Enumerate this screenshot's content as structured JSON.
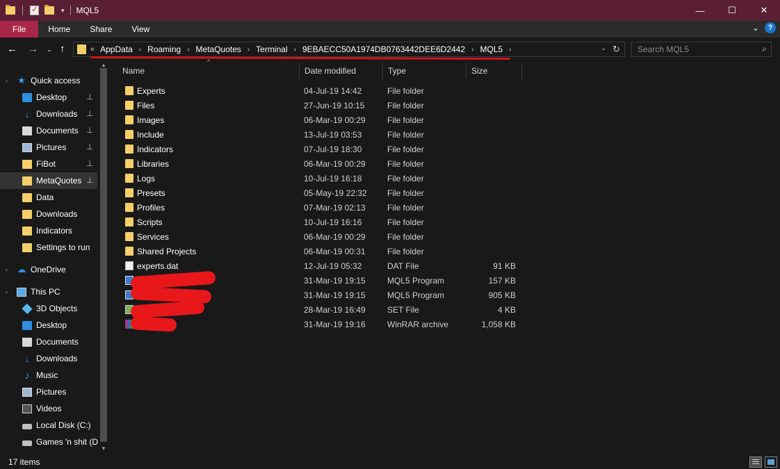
{
  "window": {
    "title": "MQL5",
    "minimize_glyph": "—",
    "maximize_glyph": "☐",
    "close_glyph": "✕"
  },
  "ribbon": {
    "tabs": [
      "File",
      "Home",
      "Share",
      "View"
    ],
    "help_glyph": "?",
    "expand_glyph": "⌄"
  },
  "address": {
    "prefix": "«",
    "crumbs": [
      "AppData",
      "Roaming",
      "MetaQuotes",
      "Terminal",
      "9EBAECC50A1974DB0763442DEE6D2442",
      "MQL5"
    ],
    "separator": "›",
    "refresh_glyph": "↻",
    "dropdown_glyph": "⌄"
  },
  "nav_buttons": {
    "back": "←",
    "forward": "→",
    "recent": "⌄",
    "up": "↑"
  },
  "search": {
    "placeholder": "Search MQL5",
    "value": "",
    "icon_glyph": "⌕"
  },
  "navpane": {
    "items": [
      {
        "label": "Quick access",
        "icon": "star-icon",
        "pinned": false,
        "selected": false,
        "group": true
      },
      {
        "label": "Desktop",
        "icon": "desktop-icon",
        "pinned": true,
        "selected": false
      },
      {
        "label": "Downloads",
        "icon": "download-icon",
        "pinned": true,
        "selected": false
      },
      {
        "label": "Documents",
        "icon": "document-icon",
        "pinned": true,
        "selected": false
      },
      {
        "label": "Pictures",
        "icon": "pictures-icon",
        "pinned": true,
        "selected": false
      },
      {
        "label": "FiBot",
        "icon": "folder-icon",
        "pinned": true,
        "selected": false
      },
      {
        "label": "MetaQuotes",
        "icon": "folder-icon",
        "pinned": true,
        "selected": true
      },
      {
        "label": "Data",
        "icon": "folder-icon",
        "pinned": false,
        "selected": false
      },
      {
        "label": "Downloads",
        "icon": "folder-icon",
        "pinned": false,
        "selected": false
      },
      {
        "label": "Indicators",
        "icon": "folder-icon",
        "pinned": false,
        "selected": false
      },
      {
        "label": "Settings to run",
        "icon": "folder-icon",
        "pinned": false,
        "selected": false
      },
      {
        "label": "OneDrive",
        "icon": "cloud-icon",
        "pinned": false,
        "selected": false,
        "group": true
      },
      {
        "label": "This PC",
        "icon": "pc-icon",
        "pinned": false,
        "selected": false,
        "group": true
      },
      {
        "label": "3D Objects",
        "icon": "cube-icon",
        "pinned": false,
        "selected": false
      },
      {
        "label": "Desktop",
        "icon": "desktop-icon",
        "pinned": false,
        "selected": false
      },
      {
        "label": "Documents",
        "icon": "document-icon",
        "pinned": false,
        "selected": false
      },
      {
        "label": "Downloads",
        "icon": "download-icon",
        "pinned": false,
        "selected": false
      },
      {
        "label": "Music",
        "icon": "music-icon",
        "pinned": false,
        "selected": false
      },
      {
        "label": "Pictures",
        "icon": "pictures-icon",
        "pinned": false,
        "selected": false
      },
      {
        "label": "Videos",
        "icon": "video-icon",
        "pinned": false,
        "selected": false
      },
      {
        "label": "Local Disk (C:)",
        "icon": "disk-icon",
        "pinned": false,
        "selected": false
      },
      {
        "label": "Games 'n shit (D",
        "icon": "disk-icon",
        "pinned": false,
        "selected": false
      }
    ],
    "pin_glyph": "📌"
  },
  "columns": [
    "Name",
    "Date modified",
    "Type",
    "Size"
  ],
  "files": [
    {
      "name": "Experts",
      "date": "04-Jul-19 14:42",
      "type": "File folder",
      "size": "",
      "icon": "folder-icon",
      "redacted": false
    },
    {
      "name": "Files",
      "date": "27-Jun-19 10:15",
      "type": "File folder",
      "size": "",
      "icon": "folder-icon",
      "redacted": false
    },
    {
      "name": "Images",
      "date": "06-Mar-19 00:29",
      "type": "File folder",
      "size": "",
      "icon": "folder-icon",
      "redacted": false
    },
    {
      "name": "Include",
      "date": "13-Jul-19 03:53",
      "type": "File folder",
      "size": "",
      "icon": "folder-icon",
      "redacted": false
    },
    {
      "name": "Indicators",
      "date": "07-Jul-19 18:30",
      "type": "File folder",
      "size": "",
      "icon": "folder-icon",
      "redacted": false
    },
    {
      "name": "Libraries",
      "date": "06-Mar-19 00:29",
      "type": "File folder",
      "size": "",
      "icon": "folder-icon",
      "redacted": false
    },
    {
      "name": "Logs",
      "date": "10-Jul-19 16:18",
      "type": "File folder",
      "size": "",
      "icon": "folder-icon",
      "redacted": false
    },
    {
      "name": "Presets",
      "date": "05-May-19 22:32",
      "type": "File folder",
      "size": "",
      "icon": "folder-icon",
      "redacted": false
    },
    {
      "name": "Profiles",
      "date": "07-Mar-19 02:13",
      "type": "File folder",
      "size": "",
      "icon": "folder-icon",
      "redacted": false
    },
    {
      "name": "Scripts",
      "date": "10-Jul-19 16:16",
      "type": "File folder",
      "size": "",
      "icon": "folder-icon",
      "redacted": false
    },
    {
      "name": "Services",
      "date": "06-Mar-19 00:29",
      "type": "File folder",
      "size": "",
      "icon": "folder-icon",
      "redacted": false
    },
    {
      "name": "Shared Projects",
      "date": "06-Mar-19 00:31",
      "type": "File folder",
      "size": "",
      "icon": "folder-icon",
      "redacted": false
    },
    {
      "name": "experts.dat",
      "date": "12-Jul-19 05:32",
      "type": "DAT File",
      "size": "91 KB",
      "icon": "file-icon",
      "redacted": false
    },
    {
      "name": "",
      "date": "31-Mar-19 19:15",
      "type": "MQL5 Program",
      "size": "157 KB",
      "icon": "mql5-program-icon",
      "redacted": true
    },
    {
      "name": "",
      "date": "31-Mar-19 19:15",
      "type": "MQL5 Program",
      "size": "905 KB",
      "icon": "mql5-program-icon",
      "redacted": true
    },
    {
      "name": "",
      "date": "28-Mar-19 16:49",
      "type": "SET File",
      "size": "4 KB",
      "icon": "set-file-icon",
      "redacted": true
    },
    {
      "name": "",
      "date": "31-Mar-19 19:16",
      "type": "WinRAR archive",
      "size": "1,058 KB",
      "icon": "winrar-archive-icon",
      "redacted": true
    }
  ],
  "status": {
    "item_count": "17 items"
  },
  "colors": {
    "titlebar": "#5a1f35",
    "file_tab": "#a82648",
    "background": "#191919",
    "folder": "#f4cf6a",
    "redaction": "#e8171a"
  }
}
